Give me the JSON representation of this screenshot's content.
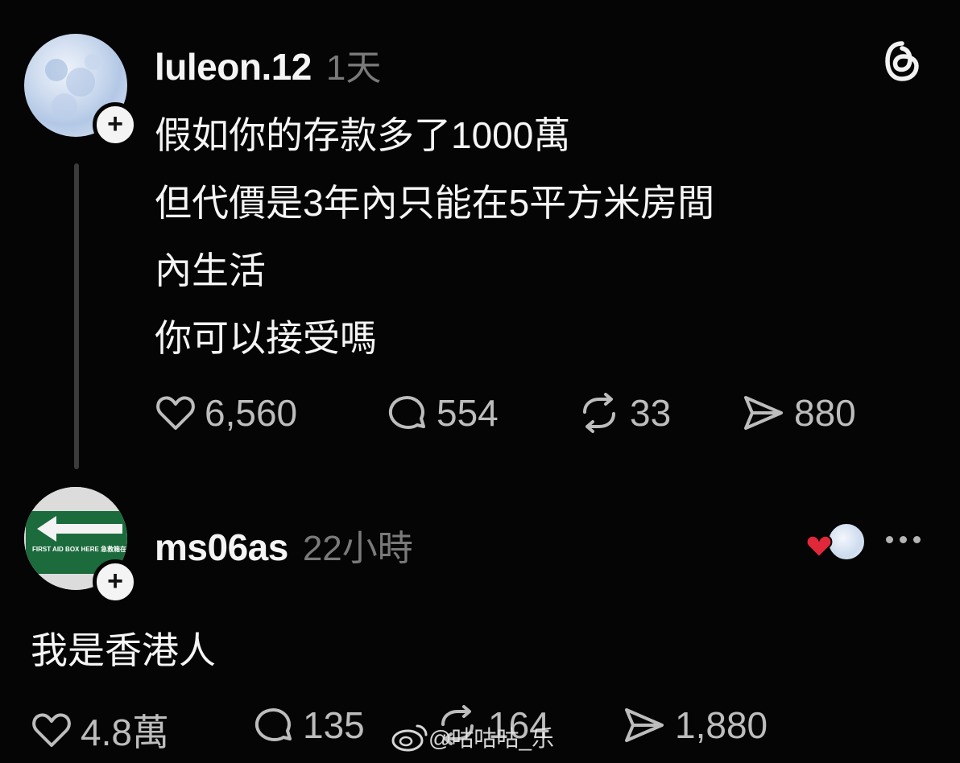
{
  "post": {
    "username": "luleon.12",
    "time": "1天",
    "lines": [
      "假如你的存款多了1000萬",
      "但代價是3年內只能在5平方米房間",
      "內生活",
      "你可以接受嗎"
    ],
    "likes": "6,560",
    "comments": "554",
    "reposts": "33",
    "shares": "880"
  },
  "reply": {
    "username": "ms06as",
    "time": "22小時",
    "avatar_sign_text": "FIRST AID BOX HERE 急救箱在",
    "text": "我是香港人",
    "likes": "4.8萬",
    "comments": "135",
    "reposts": "164",
    "shares": "1,880"
  },
  "watermark": "@咕咕咕_乐",
  "icons": [
    "threads-logo-icon",
    "follow-plus-icon",
    "heart-icon",
    "comment-icon",
    "repost-icon",
    "share-icon",
    "more-icon",
    "liked-by-author-icon"
  ],
  "colors": {
    "background": "#050505",
    "text": "#f5f5f5",
    "muted": "#7a7a7a",
    "heart_badge": "#e0283a"
  }
}
